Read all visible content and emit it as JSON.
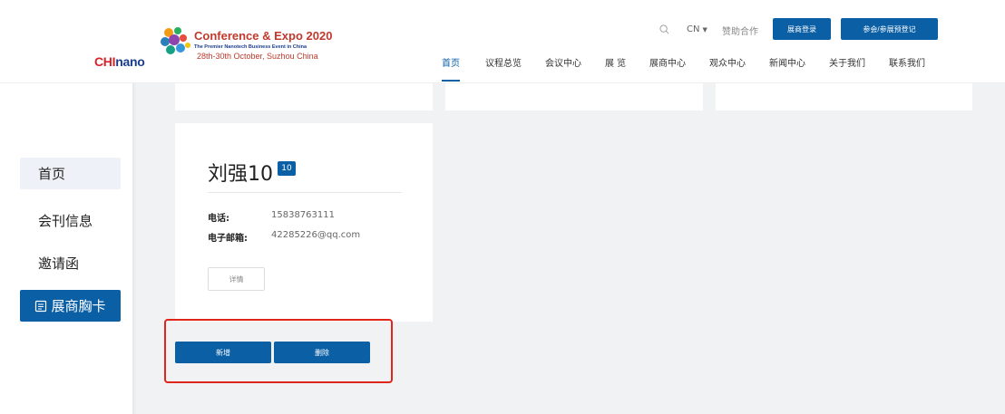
{
  "logo": {
    "brand_prefix": "CHI",
    "brand_suffix": "nano",
    "title": "Conference & Expo 2020",
    "subtitle": "The Premier Nanotech Business Event in China",
    "date": "28th-30th October, Suzhou China"
  },
  "header": {
    "lang": "CN",
    "sponsor": "赞助合作",
    "exhibitor_login": "展商登录",
    "visitor_register": "参会/参展预登记"
  },
  "nav": [
    "首页",
    "议程总览",
    "会议中心",
    "展 览",
    "展商中心",
    "观众中心",
    "新闻中心",
    "关于我们",
    "联系我们"
  ],
  "sidebar": {
    "items": [
      {
        "label": "首页"
      },
      {
        "label": "会刊信息"
      },
      {
        "label": "邀请函"
      },
      {
        "label": "展商胸卡"
      }
    ]
  },
  "card": {
    "name": "刘强10",
    "badge": "10",
    "phone_label": "电话:",
    "phone": "15838763111",
    "email_label": "电子邮箱:",
    "email": "42285226@qq.com",
    "detail_label": "详情"
  },
  "actions": {
    "add_label": "新增",
    "delete_label": "删除"
  },
  "colors": {
    "primary": "#0b5fa5",
    "highlight": "#e0251b"
  }
}
